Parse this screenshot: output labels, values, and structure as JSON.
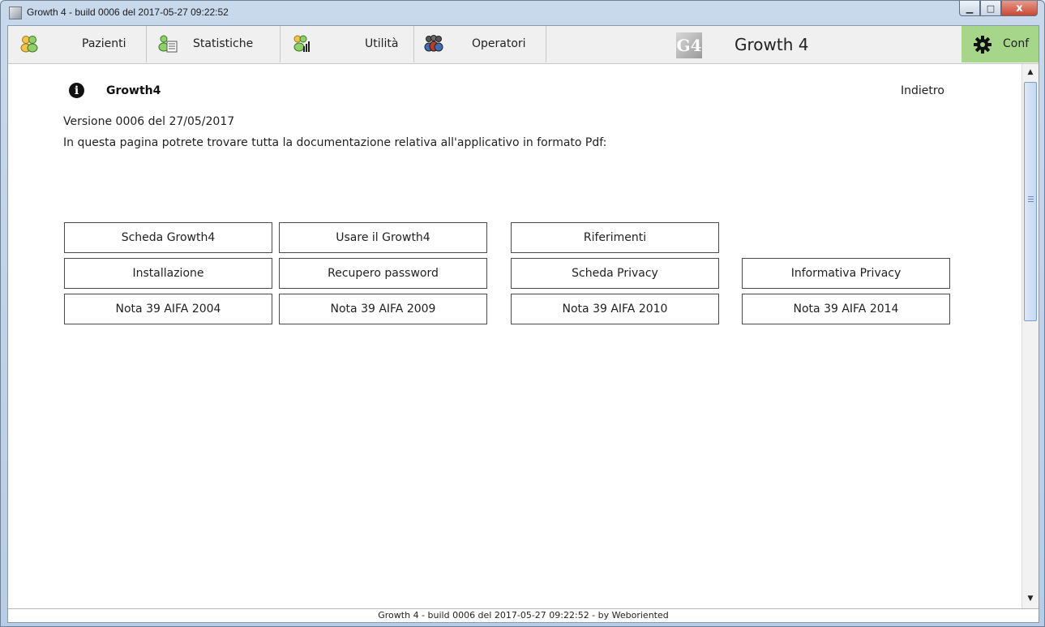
{
  "window": {
    "title": "Growth 4 - build 0006 del 2017-05-27 09:22:52",
    "minimize_glyph": "▁",
    "maximize_glyph": "□",
    "close_glyph": "x"
  },
  "menu": {
    "items": [
      {
        "label": "Pazienti",
        "icon": "patients-icon"
      },
      {
        "label": "Statistiche",
        "icon": "statistics-icon"
      },
      {
        "label": "Utilità",
        "icon": "utilities-icon"
      },
      {
        "label": "Operatori",
        "icon": "operators-icon"
      }
    ],
    "logo_text": "G4",
    "app_title": "Growth 4",
    "conf_label": "Conf",
    "conf_color": "#a5d68a"
  },
  "page": {
    "info_glyph": "i",
    "title": "Growth4",
    "back_label": "Indietro",
    "version": "Versione 0006 del 27/05/2017",
    "description": "In questa pagina potrete trovare tutta la documentazione relativa all'applicativo in formato Pdf:"
  },
  "documents": {
    "scheda_growth4": "Scheda Growth4",
    "usare_growth4": "Usare il Growth4",
    "riferimenti": "Riferimenti",
    "installazione": "Installazione",
    "recupero_password": "Recupero password",
    "scheda_privacy": "Scheda Privacy",
    "informativa_privacy": "Informativa Privacy",
    "nota_2004": "Nota 39 AIFA 2004",
    "nota_2009": "Nota 39 AIFA 2009",
    "nota_2010": "Nota 39 AIFA 2010",
    "nota_2014": "Nota 39 AIFA 2014"
  },
  "scrollbar": {
    "up_glyph": "▲",
    "down_glyph": "▼"
  },
  "status": {
    "text": "Growth 4 - build 0006 del 2017-05-27 09:22:52 - by Weboriented"
  }
}
